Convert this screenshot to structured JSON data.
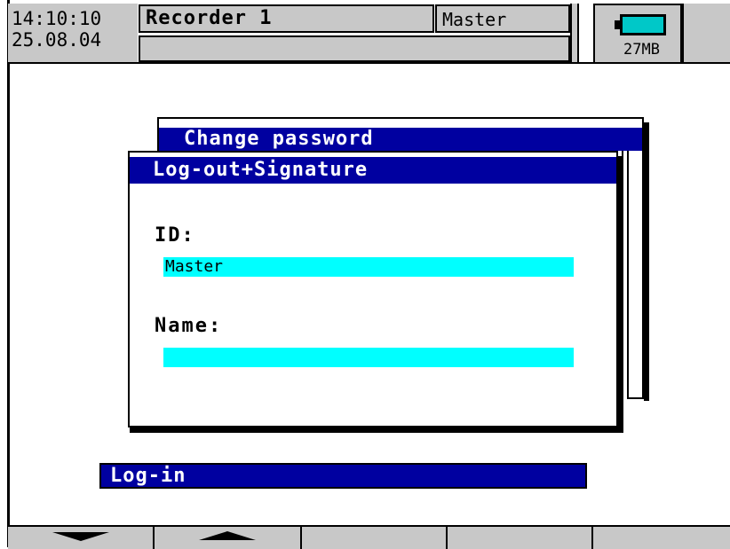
{
  "header": {
    "time": "14:10:10",
    "date": "25.08.04",
    "recorder_name": "Recorder 1",
    "user": "Master",
    "message": "",
    "memory_label": "27MB"
  },
  "dialogs": {
    "back_title": "Change password",
    "front_title": "Log-out+Signature",
    "id_label": "ID:",
    "id_value": "Master",
    "name_label": "Name:",
    "name_value": ""
  },
  "menu": {
    "login_label": "Log-in"
  },
  "softkeys": [
    {
      "icon": "arrow-down-icon"
    },
    {
      "icon": "arrow-up-icon"
    },
    {
      "icon": ""
    },
    {
      "icon": ""
    },
    {
      "icon": ""
    }
  ],
  "colors": {
    "title_bar": "#0000a0",
    "input_field": "#00ffff",
    "panel_gray": "#c8c8c8",
    "battery": "#00c8c8"
  }
}
